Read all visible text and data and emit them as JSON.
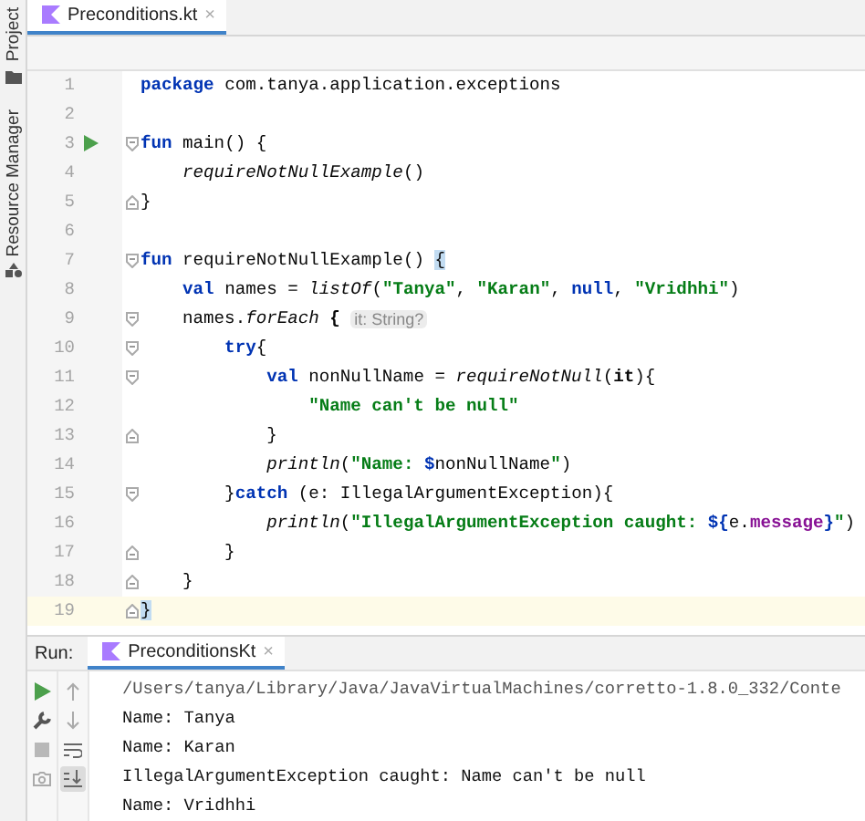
{
  "side_panel": {
    "tools": [
      {
        "label": "Project",
        "kind": "folder"
      },
      {
        "label": "Resource Manager",
        "kind": "resources"
      }
    ]
  },
  "editor_tabs": [
    {
      "label": "Preconditions.kt",
      "selected": true,
      "close": "×"
    }
  ],
  "code_lines": [
    {
      "number": "1",
      "tokens": [
        {
          "text": "package",
          "kind": "keyword"
        },
        {
          "text": " com.tanya.application.exceptions",
          "kind": "plain"
        }
      ]
    },
    {
      "number": "2"
    },
    {
      "number": "3",
      "run": true,
      "fold_start": true,
      "tokens": [
        {
          "text": "fun",
          "kind": "keyword"
        },
        {
          "text": " main() {",
          "kind": "plain"
        }
      ]
    },
    {
      "number": "4",
      "tokens": [
        {
          "text": "    requireNotNullExample",
          "kind": "call"
        },
        {
          "text": "()",
          "kind": "plain"
        }
      ]
    },
    {
      "number": "5",
      "fold_end": true,
      "tokens": [
        {
          "text": "}",
          "kind": "plain"
        }
      ]
    },
    {
      "number": "6"
    },
    {
      "number": "7",
      "fold_start": true,
      "tokens": [
        {
          "text": "fun",
          "kind": "keyword"
        },
        {
          "text": " requireNotNullExample() ",
          "kind": "plain"
        },
        {
          "text": "{",
          "kind": "matched"
        }
      ]
    },
    {
      "number": "8",
      "tokens": [
        {
          "text": "    val",
          "kind": "keyword"
        },
        {
          "text": " names = ",
          "kind": "plain"
        },
        {
          "text": "listOf",
          "kind": "call"
        },
        {
          "text": "(",
          "kind": "plain"
        },
        {
          "text": "\"Tanya\"",
          "kind": "string"
        },
        {
          "text": ", ",
          "kind": "plain"
        },
        {
          "text": "\"Karan\"",
          "kind": "string"
        },
        {
          "text": ", ",
          "kind": "plain"
        },
        {
          "text": "null",
          "kind": "keyword"
        },
        {
          "text": ", ",
          "kind": "plain"
        },
        {
          "text": "\"Vridhhi\"",
          "kind": "string"
        },
        {
          "text": ")",
          "kind": "plain"
        }
      ]
    },
    {
      "number": "9",
      "fold_start": true,
      "tokens": [
        {
          "text": "    names.",
          "kind": "plain"
        },
        {
          "text": "forEach",
          "kind": "call"
        },
        {
          "text": " { ",
          "kind": "bold"
        },
        {
          "text": "it: String?",
          "kind": "hint"
        }
      ]
    },
    {
      "number": "10",
      "fold_start": true,
      "tokens": [
        {
          "text": "        try",
          "kind": "keyword"
        },
        {
          "text": "{",
          "kind": "plain"
        }
      ]
    },
    {
      "number": "11",
      "fold_start": true,
      "tokens": [
        {
          "text": "            val",
          "kind": "keyword"
        },
        {
          "text": " nonNullName = ",
          "kind": "plain"
        },
        {
          "text": "requireNotNull",
          "kind": "call"
        },
        {
          "text": "(",
          "kind": "plain"
        },
        {
          "text": "it",
          "kind": "bold"
        },
        {
          "text": "){",
          "kind": "plain"
        }
      ]
    },
    {
      "number": "12",
      "tokens": [
        {
          "text": "                \"Name can't be null\"",
          "kind": "string"
        }
      ]
    },
    {
      "number": "13",
      "fold_end": true,
      "tokens": [
        {
          "text": "            }",
          "kind": "plain"
        }
      ]
    },
    {
      "number": "14",
      "tokens": [
        {
          "text": "            println",
          "kind": "call"
        },
        {
          "text": "(",
          "kind": "plain"
        },
        {
          "text": "\"Name: ",
          "kind": "string"
        },
        {
          "text": "$",
          "kind": "keyword"
        },
        {
          "text": "nonNullName",
          "kind": "plain"
        },
        {
          "text": "\"",
          "kind": "string"
        },
        {
          "text": ")",
          "kind": "plain"
        }
      ]
    },
    {
      "number": "15",
      "fold_start": true,
      "tokens": [
        {
          "text": "        }",
          "kind": "plain"
        },
        {
          "text": "catch",
          "kind": "keyword"
        },
        {
          "text": " (e: IllegalArgumentException){",
          "kind": "plain"
        }
      ]
    },
    {
      "number": "16",
      "tokens": [
        {
          "text": "            println",
          "kind": "call"
        },
        {
          "text": "(",
          "kind": "plain"
        },
        {
          "text": "\"IllegalArgumentException caught: ",
          "kind": "string"
        },
        {
          "text": "${",
          "kind": "keyword"
        },
        {
          "text": "e.",
          "kind": "plain"
        },
        {
          "text": "message",
          "kind": "property"
        },
        {
          "text": "}",
          "kind": "keyword"
        },
        {
          "text": "\"",
          "kind": "string"
        },
        {
          "text": ")",
          "kind": "plain"
        }
      ]
    },
    {
      "number": "17",
      "fold_end": true,
      "tokens": [
        {
          "text": "        }",
          "kind": "plain"
        }
      ]
    },
    {
      "number": "18",
      "fold_end": true,
      "tokens": [
        {
          "text": "    }",
          "kind": "plain"
        }
      ]
    },
    {
      "number": "19",
      "current": true,
      "fold_end": true,
      "tokens": [
        {
          "text": "}",
          "kind": "matched"
        }
      ]
    }
  ],
  "run_panel": {
    "title": "Run:",
    "tabs": [
      {
        "label": "PreconditionsKt",
        "selected": true,
        "close": "×"
      }
    ],
    "tools": [
      {
        "kind": "play"
      },
      {
        "kind": "wrench"
      },
      {
        "kind": "stop"
      },
      {
        "kind": "camera"
      }
    ],
    "nav_tools": [
      {
        "kind": "up",
        "selected": false
      },
      {
        "kind": "down",
        "selected": false
      },
      {
        "kind": "wrap",
        "selected": false
      },
      {
        "kind": "scroll-end",
        "selected": true
      }
    ],
    "output": [
      {
        "text": "/Users/tanya/Library/Java/JavaVirtualMachines/corretto-1.8.0_332/Conte",
        "kind": "command"
      },
      {
        "text": "Name: Tanya",
        "kind": "stdout"
      },
      {
        "text": "Name: Karan",
        "kind": "stdout"
      },
      {
        "text": "IllegalArgumentException caught: Name can't be null",
        "kind": "stdout"
      },
      {
        "text": "Name: Vridhhi",
        "kind": "stdout"
      }
    ]
  }
}
